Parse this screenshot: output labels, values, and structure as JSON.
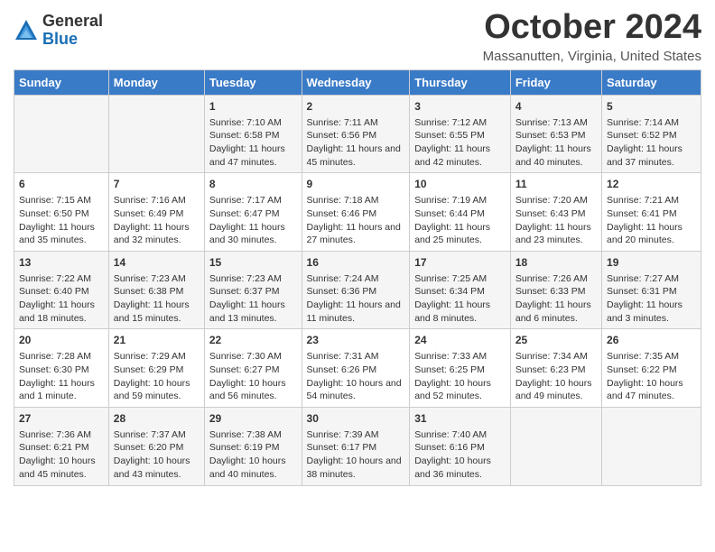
{
  "logo": {
    "general": "General",
    "blue": "Blue"
  },
  "title": "October 2024",
  "location": "Massanutten, Virginia, United States",
  "days_of_week": [
    "Sunday",
    "Monday",
    "Tuesday",
    "Wednesday",
    "Thursday",
    "Friday",
    "Saturday"
  ],
  "weeks": [
    [
      {
        "day": "",
        "content": ""
      },
      {
        "day": "",
        "content": ""
      },
      {
        "day": "1",
        "content": "Sunrise: 7:10 AM\nSunset: 6:58 PM\nDaylight: 11 hours and 47 minutes."
      },
      {
        "day": "2",
        "content": "Sunrise: 7:11 AM\nSunset: 6:56 PM\nDaylight: 11 hours and 45 minutes."
      },
      {
        "day": "3",
        "content": "Sunrise: 7:12 AM\nSunset: 6:55 PM\nDaylight: 11 hours and 42 minutes."
      },
      {
        "day": "4",
        "content": "Sunrise: 7:13 AM\nSunset: 6:53 PM\nDaylight: 11 hours and 40 minutes."
      },
      {
        "day": "5",
        "content": "Sunrise: 7:14 AM\nSunset: 6:52 PM\nDaylight: 11 hours and 37 minutes."
      }
    ],
    [
      {
        "day": "6",
        "content": "Sunrise: 7:15 AM\nSunset: 6:50 PM\nDaylight: 11 hours and 35 minutes."
      },
      {
        "day": "7",
        "content": "Sunrise: 7:16 AM\nSunset: 6:49 PM\nDaylight: 11 hours and 32 minutes."
      },
      {
        "day": "8",
        "content": "Sunrise: 7:17 AM\nSunset: 6:47 PM\nDaylight: 11 hours and 30 minutes."
      },
      {
        "day": "9",
        "content": "Sunrise: 7:18 AM\nSunset: 6:46 PM\nDaylight: 11 hours and 27 minutes."
      },
      {
        "day": "10",
        "content": "Sunrise: 7:19 AM\nSunset: 6:44 PM\nDaylight: 11 hours and 25 minutes."
      },
      {
        "day": "11",
        "content": "Sunrise: 7:20 AM\nSunset: 6:43 PM\nDaylight: 11 hours and 23 minutes."
      },
      {
        "day": "12",
        "content": "Sunrise: 7:21 AM\nSunset: 6:41 PM\nDaylight: 11 hours and 20 minutes."
      }
    ],
    [
      {
        "day": "13",
        "content": "Sunrise: 7:22 AM\nSunset: 6:40 PM\nDaylight: 11 hours and 18 minutes."
      },
      {
        "day": "14",
        "content": "Sunrise: 7:23 AM\nSunset: 6:38 PM\nDaylight: 11 hours and 15 minutes."
      },
      {
        "day": "15",
        "content": "Sunrise: 7:23 AM\nSunset: 6:37 PM\nDaylight: 11 hours and 13 minutes."
      },
      {
        "day": "16",
        "content": "Sunrise: 7:24 AM\nSunset: 6:36 PM\nDaylight: 11 hours and 11 minutes."
      },
      {
        "day": "17",
        "content": "Sunrise: 7:25 AM\nSunset: 6:34 PM\nDaylight: 11 hours and 8 minutes."
      },
      {
        "day": "18",
        "content": "Sunrise: 7:26 AM\nSunset: 6:33 PM\nDaylight: 11 hours and 6 minutes."
      },
      {
        "day": "19",
        "content": "Sunrise: 7:27 AM\nSunset: 6:31 PM\nDaylight: 11 hours and 3 minutes."
      }
    ],
    [
      {
        "day": "20",
        "content": "Sunrise: 7:28 AM\nSunset: 6:30 PM\nDaylight: 11 hours and 1 minute."
      },
      {
        "day": "21",
        "content": "Sunrise: 7:29 AM\nSunset: 6:29 PM\nDaylight: 10 hours and 59 minutes."
      },
      {
        "day": "22",
        "content": "Sunrise: 7:30 AM\nSunset: 6:27 PM\nDaylight: 10 hours and 56 minutes."
      },
      {
        "day": "23",
        "content": "Sunrise: 7:31 AM\nSunset: 6:26 PM\nDaylight: 10 hours and 54 minutes."
      },
      {
        "day": "24",
        "content": "Sunrise: 7:33 AM\nSunset: 6:25 PM\nDaylight: 10 hours and 52 minutes."
      },
      {
        "day": "25",
        "content": "Sunrise: 7:34 AM\nSunset: 6:23 PM\nDaylight: 10 hours and 49 minutes."
      },
      {
        "day": "26",
        "content": "Sunrise: 7:35 AM\nSunset: 6:22 PM\nDaylight: 10 hours and 47 minutes."
      }
    ],
    [
      {
        "day": "27",
        "content": "Sunrise: 7:36 AM\nSunset: 6:21 PM\nDaylight: 10 hours and 45 minutes."
      },
      {
        "day": "28",
        "content": "Sunrise: 7:37 AM\nSunset: 6:20 PM\nDaylight: 10 hours and 43 minutes."
      },
      {
        "day": "29",
        "content": "Sunrise: 7:38 AM\nSunset: 6:19 PM\nDaylight: 10 hours and 40 minutes."
      },
      {
        "day": "30",
        "content": "Sunrise: 7:39 AM\nSunset: 6:17 PM\nDaylight: 10 hours and 38 minutes."
      },
      {
        "day": "31",
        "content": "Sunrise: 7:40 AM\nSunset: 6:16 PM\nDaylight: 10 hours and 36 minutes."
      },
      {
        "day": "",
        "content": ""
      },
      {
        "day": "",
        "content": ""
      }
    ]
  ]
}
